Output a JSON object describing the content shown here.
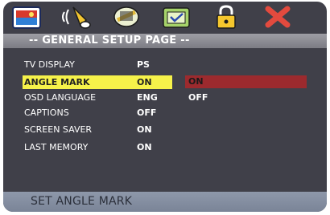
{
  "toolbar": {
    "icons": [
      "general-setup-icon",
      "audio-setup-icon",
      "video-setup-icon",
      "preference-icon",
      "password-lock-icon",
      "exit-icon"
    ]
  },
  "header": {
    "title": "-- GENERAL SETUP PAGE --"
  },
  "menu": {
    "items": [
      {
        "label": "TV DISPLAY",
        "value": "PS"
      },
      {
        "label": "ANGLE MARK",
        "value": "ON"
      },
      {
        "label": "OSD LANGUAGE",
        "value": "ENG"
      },
      {
        "label": "CAPTIONS",
        "value": "OFF"
      },
      {
        "label": "SCREEN SAVER",
        "value": "ON"
      },
      {
        "label": "LAST MEMORY",
        "value": "ON"
      }
    ],
    "selected_index": 1
  },
  "options": {
    "items": [
      "ON",
      "OFF"
    ],
    "selected_index": 0
  },
  "footer": {
    "hint": "SET ANGLE MARK"
  },
  "colors": {
    "background": "#404049",
    "header_bar": "#8a8a92",
    "selected_row": "#f6f24a",
    "selected_option": "#9c2a2e",
    "footer_bar": "#8690a3"
  }
}
